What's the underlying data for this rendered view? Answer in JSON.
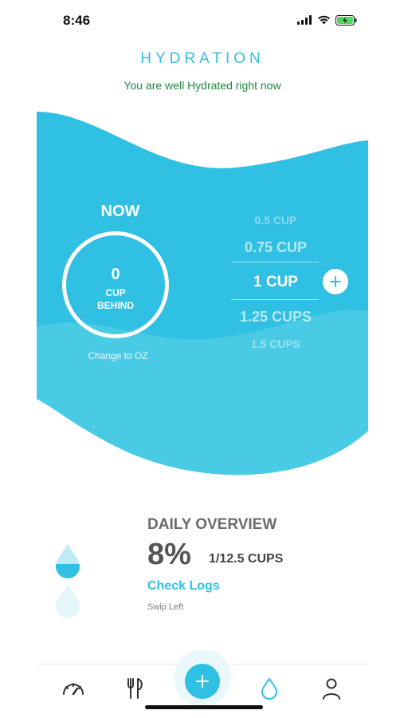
{
  "status_bar": {
    "time": "8:46",
    "icons": [
      "signal-icon",
      "wifi-icon",
      "battery-charging-icon"
    ]
  },
  "header": {
    "title": "HYDRATION",
    "subtitle": "You are well Hydrated right now"
  },
  "now_panel": {
    "label": "NOW",
    "value": "0",
    "caption_line1": "CUP",
    "caption_line2": "BEHIND",
    "unit_toggle": "Change to OZ"
  },
  "cup_picker": {
    "options": [
      "0.5 CUP",
      "0.75 CUP",
      "1 CUP",
      "1.25 CUPS",
      "1.5 CUPS"
    ],
    "selected": "1 CUP",
    "add_icon": "plus-icon"
  },
  "daily_overview": {
    "title": "DAILY OVERVIEW",
    "percent": "8%",
    "cups": "1/12.5 CUPS",
    "check_logs": "Check Logs",
    "hint": "Swip Left",
    "progress_fraction": 0.08
  },
  "tab_bar": {
    "tabs": [
      {
        "name": "dashboard",
        "icon": "speedometer-icon"
      },
      {
        "name": "food",
        "icon": "fork-knife-icon"
      },
      {
        "name": "add",
        "icon": "plus-icon"
      },
      {
        "name": "hydration",
        "icon": "water-drop-icon"
      },
      {
        "name": "profile",
        "icon": "person-icon"
      }
    ],
    "active": "hydration"
  },
  "colors": {
    "accent": "#2fc0e3",
    "wave_light": "#49cbe6",
    "green_text": "#1d8a3d"
  }
}
